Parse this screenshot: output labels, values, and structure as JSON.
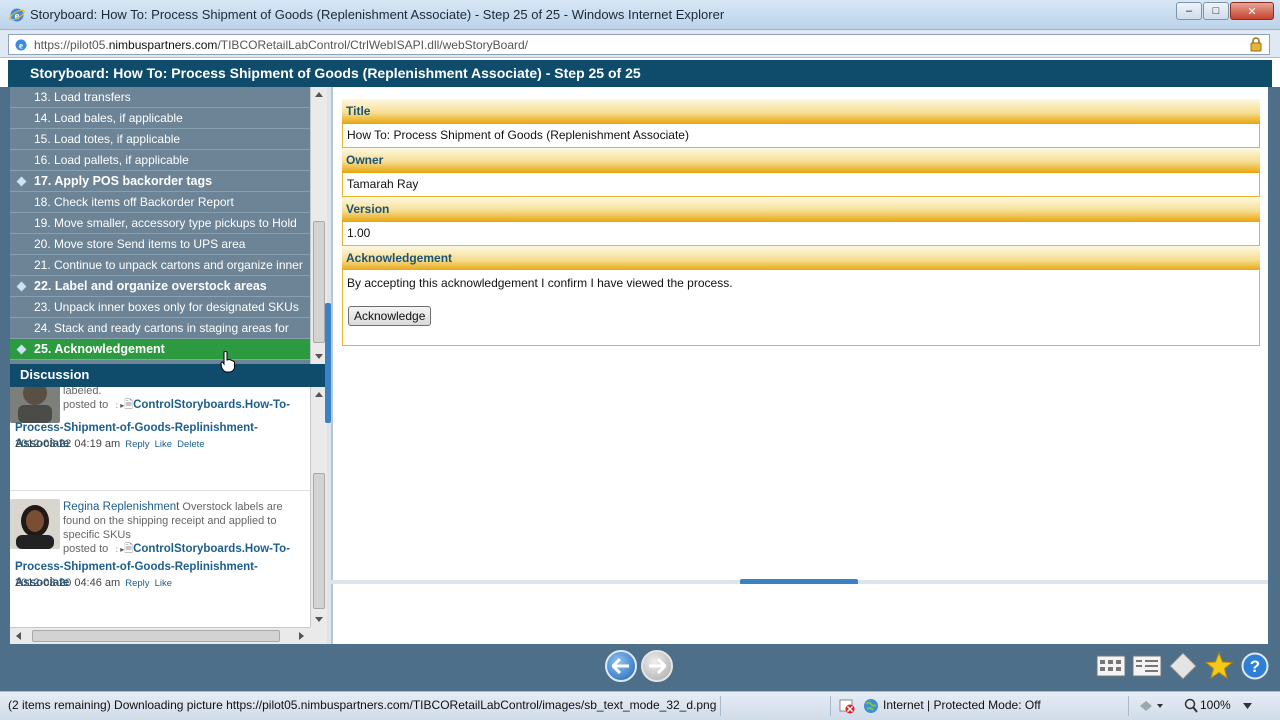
{
  "window": {
    "title": "Storyboard: How To: Process Shipment of Goods (Replenishment Associate) - Step 25 of 25 - Windows Internet Explorer",
    "min_glyph": "–",
    "max_glyph": "□",
    "close_glyph": "✕"
  },
  "address": {
    "url_prefix": "https://pilot05.",
    "url_domain": "nimbuspartners.com",
    "url_path": "/TIBCORetailLabControl/CtrlWebISAPI.dll/webStoryBoard/"
  },
  "storyboard": {
    "header": "Storyboard: How To: Process Shipment of Goods (Replenishment Associate) - Step 25 of 25"
  },
  "steps": [
    {
      "label": "13. Load transfers",
      "bold": false
    },
    {
      "label": "14. Load bales, if applicable",
      "bold": false
    },
    {
      "label": "15. Load totes, if applicable",
      "bold": false
    },
    {
      "label": "16. Load pallets, if applicable",
      "bold": false
    },
    {
      "label": "17. Apply POS backorder tags",
      "bold": true
    },
    {
      "label": "18. Check items off Backorder Report",
      "bold": false
    },
    {
      "label": "19. Move smaller, accessory type pickups to Hold",
      "bold": false
    },
    {
      "label": "20. Move store Send items to UPS area",
      "bold": false
    },
    {
      "label": "21. Continue to unpack cartons and organize inner",
      "bold": false
    },
    {
      "label": "22. Label and organize overstock areas",
      "bold": true
    },
    {
      "label": "23. Unpack inner boxes only for designated SKUs",
      "bold": false
    },
    {
      "label": "24. Stack and ready cartons in staging areas for",
      "bold": false
    },
    {
      "label": "25. Acknowledgement",
      "bold": true,
      "active": true
    }
  ],
  "discussion": {
    "title": "Discussion",
    "posts": [
      {
        "text": "labeled.",
        "posted_to": "posted to",
        "link_part1": "ControlStoryboards.How-To-",
        "link_part2": "Process-Shipment-of-Goods-Replinishment-Associate",
        "date": "2012-03-22 04:19 am",
        "actions": [
          "Reply",
          "Like",
          "Delete"
        ]
      },
      {
        "author": "Regina Replenishment",
        "text": " Overstock labels are found on the shipping receipt and applied to specific SKUs",
        "posted_to": "posted to",
        "link_part1": "ControlStoryboards.How-To-",
        "link_part2": "Process-Shipment-of-Goods-Replinishment-Associate",
        "date": "2012-03-20 04:46 am",
        "actions": [
          "Reply",
          "Like"
        ]
      }
    ]
  },
  "content": {
    "title_label": "Title",
    "title_value": "How To: Process Shipment of Goods (Replenishment Associate)",
    "owner_label": "Owner",
    "owner_value": "Tamarah Ray",
    "version_label": "Version",
    "version_value": "1.00",
    "ack_label": "Acknowledgement",
    "ack_text": "By accepting this acknowledgement I confirm I have viewed the process.",
    "ack_button": "Acknowledge"
  },
  "status": {
    "text": "(2 items remaining) Downloading picture https://pilot05.nimbuspartners.com/TIBCORetailLabControl/images/sb_text_mode_32_d.png...",
    "zone": "Internet | Protected Mode: Off",
    "zoom": "100%"
  },
  "colors": {
    "header_bg": "#0f4c6c",
    "active_step": "#2c9a3f",
    "section_gold": "#e8a40a"
  }
}
